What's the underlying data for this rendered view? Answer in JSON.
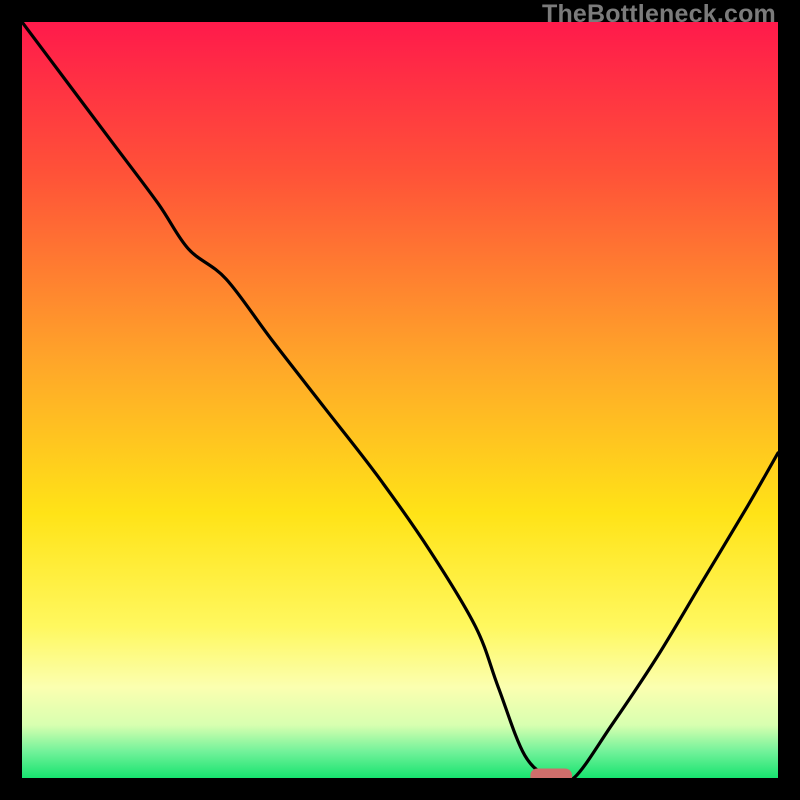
{
  "watermark": "TheBottleneck.com",
  "chart_data": {
    "type": "line",
    "title": "",
    "xlabel": "",
    "ylabel": "",
    "xlim": [
      0,
      100
    ],
    "ylim": [
      0,
      100
    ],
    "gradient_stops": [
      {
        "pos": 0.0,
        "color": "#ff1a4b"
      },
      {
        "pos": 0.2,
        "color": "#ff5238"
      },
      {
        "pos": 0.45,
        "color": "#ffa629"
      },
      {
        "pos": 0.65,
        "color": "#ffe317"
      },
      {
        "pos": 0.8,
        "color": "#fff85f"
      },
      {
        "pos": 0.88,
        "color": "#fbffb0"
      },
      {
        "pos": 0.93,
        "color": "#d8ffb0"
      },
      {
        "pos": 0.965,
        "color": "#72f29a"
      },
      {
        "pos": 1.0,
        "color": "#17e36f"
      }
    ],
    "series": [
      {
        "name": "bottleneck-curve",
        "x": [
          0,
          6,
          12,
          18,
          22,
          27,
          33,
          40,
          47,
          54,
          60,
          63,
          66.5,
          70,
          73,
          78,
          84,
          90,
          96,
          100
        ],
        "y": [
          100,
          92,
          84,
          76,
          70,
          66,
          58,
          49,
          40,
          30,
          20,
          12,
          3,
          0,
          0,
          7,
          16,
          26,
          36,
          43
        ]
      }
    ],
    "marker": {
      "name": "optimal-marker",
      "x": 70,
      "y": 0,
      "width_pct": 5.5,
      "height_pct": 2.0,
      "fill": "#cf6e6b"
    }
  }
}
